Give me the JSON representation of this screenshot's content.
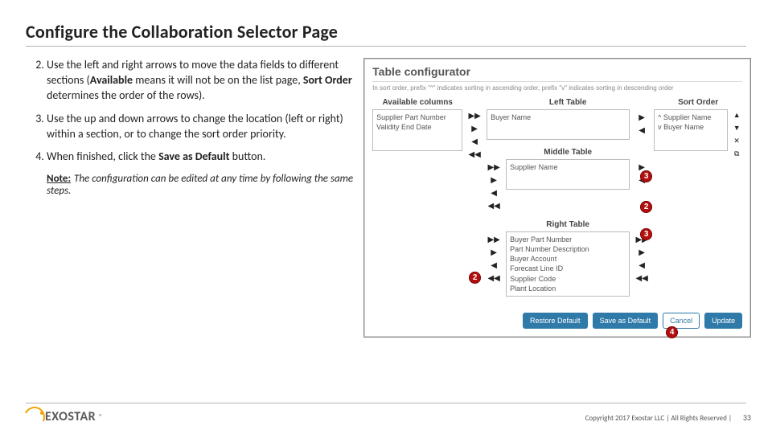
{
  "title": "Configure the Collaboration Selector Page",
  "steps": {
    "start": 2,
    "s2_pre": "Use the left and right arrows to move the data fields to different sections (",
    "s2_b1": "Available",
    "s2_mid": " means it will not be on the list page, ",
    "s2_b2": "Sort Order",
    "s2_post": " determines the order of the rows).",
    "s3": "Use the up and down arrows to change the location (left or right) within a section, or to change the sort order priority.",
    "s4_pre": "When finished, click the ",
    "s4_b": "Save as Default",
    "s4_post": " button."
  },
  "note": {
    "label": "Note:",
    "text": "The configuration can be edited at any time by following the same steps."
  },
  "shot": {
    "title": "Table configurator",
    "help": "In sort order, prefix \"^\" indicates sorting in ascending order, prefix \"v\" indicates sorting in descending order",
    "headers": {
      "available": "Available columns",
      "left": "Left Table",
      "middle": "Middle Table",
      "right": "Right Table",
      "sort": "Sort Order"
    },
    "available": [
      "Supplier Part Number",
      "Validity End Date"
    ],
    "left_table": [
      "Buyer Name"
    ],
    "middle_table": [
      "Supplier Name"
    ],
    "right_table": [
      "Buyer Part Number",
      "Part Number Description",
      "Buyer Account",
      "Forecast Line ID",
      "Supplier Code",
      "Plant Location"
    ],
    "sort_order": [
      "^ Supplier Name",
      "v Buyer Name"
    ],
    "buttons": {
      "restore": "Restore Default",
      "save": "Save as Default",
      "cancel": "Cancel",
      "update": "Update"
    },
    "callouts": {
      "c1": "2",
      "c2": "3",
      "c3": "2",
      "c4": "3",
      "c5": "4"
    }
  },
  "footer": {
    "logo": "EXOSTAR",
    "copyright": "Copyright 2017 Exostar LLC | All Rights Reserved |",
    "page": "33"
  },
  "glyph": {
    "r": "▶",
    "l": "◀",
    "rr": "▶▶",
    "ll": "◀◀",
    "u": "▲",
    "d": "▼",
    "x": "✕",
    "sq": "⧉"
  }
}
